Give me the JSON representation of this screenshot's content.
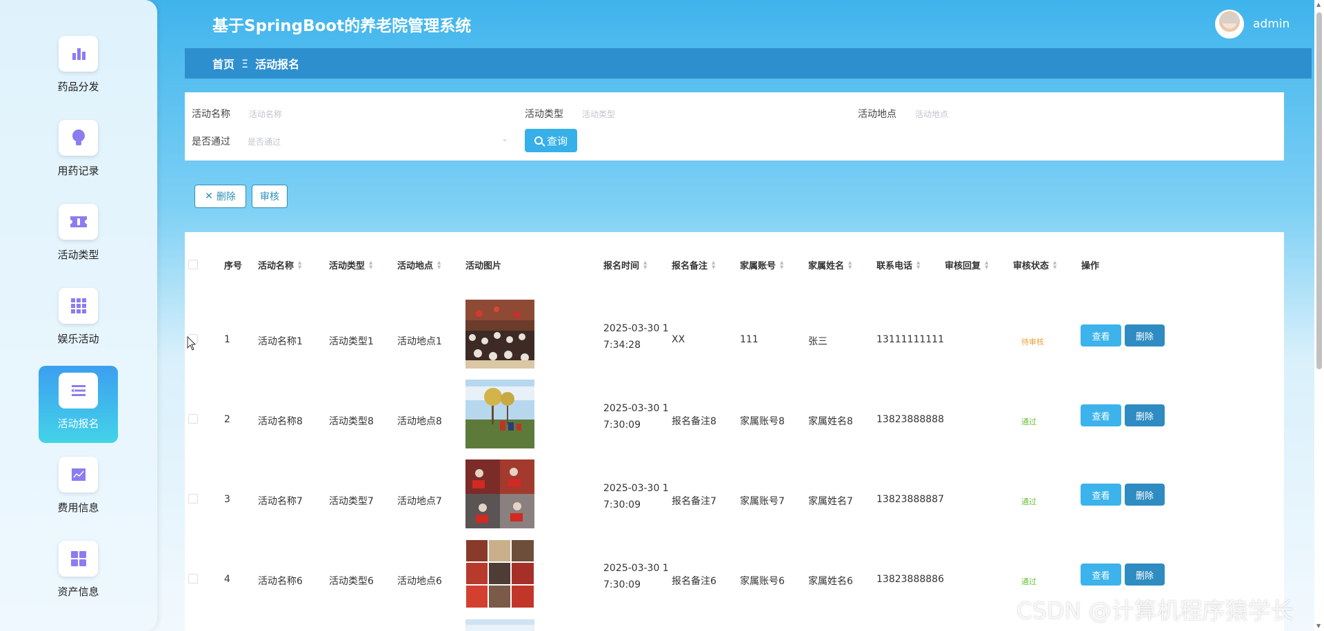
{
  "header": {
    "title": "基于SpringBoot的养老院管理系统",
    "username": "admin"
  },
  "sidebar": {
    "items": [
      {
        "label": "药品分发",
        "icon": "bar-chart-icon"
      },
      {
        "label": "用药记录",
        "icon": "lightbulb-icon"
      },
      {
        "label": "活动类型",
        "icon": "ticket-icon"
      },
      {
        "label": "娱乐活动",
        "icon": "grid-icon"
      },
      {
        "label": "活动报名",
        "icon": "list-icon",
        "active": true
      },
      {
        "label": "费用信息",
        "icon": "line-chart-icon"
      },
      {
        "label": "资产信息",
        "icon": "apps-icon"
      }
    ]
  },
  "breadcrumb": {
    "home": "首页",
    "separator": "Ξ",
    "current": "活动报名"
  },
  "search": {
    "name_label": "活动名称",
    "name_placeholder": "活动名称",
    "type_label": "活动类型",
    "type_placeholder": "活动类型",
    "place_label": "活动地点",
    "place_placeholder": "活动地点",
    "pass_label": "是否通过",
    "pass_placeholder": "是否通过",
    "search_button": "查询"
  },
  "actions": {
    "delete": "删除",
    "audit": "审核"
  },
  "table": {
    "headers": [
      "序号",
      "活动名称",
      "活动类型",
      "活动地点",
      "活动图片",
      "报名时间",
      "报名备注",
      "家属账号",
      "家属姓名",
      "联系电话",
      "审核回复",
      "审核状态",
      "操作"
    ],
    "rows": [
      {
        "index": "1",
        "name": "活动名称1",
        "type": "活动类型1",
        "place": "活动地点1",
        "time1": "2025-03-30 1",
        "time2": "7:34:28",
        "remark": "XX",
        "account": "111",
        "family_name": "张三",
        "phone": "13111111111",
        "reply": "",
        "status": "待审核"
      },
      {
        "index": "2",
        "name": "活动名称8",
        "type": "活动类型8",
        "place": "活动地点8",
        "time1": "2025-03-30 1",
        "time2": "7:30:09",
        "remark": "报名备注8",
        "account": "家属账号8",
        "family_name": "家属姓名8",
        "phone": "13823888888",
        "reply": "",
        "status": "通过"
      },
      {
        "index": "3",
        "name": "活动名称7",
        "type": "活动类型7",
        "place": "活动地点7",
        "time1": "2025-03-30 1",
        "time2": "7:30:09",
        "remark": "报名备注7",
        "account": "家属账号7",
        "family_name": "家属姓名7",
        "phone": "13823888887",
        "reply": "",
        "status": "通过"
      },
      {
        "index": "4",
        "name": "活动名称6",
        "type": "活动类型6",
        "place": "活动地点6",
        "time1": "2025-03-30 1",
        "time2": "7:30:09",
        "remark": "报名备注6",
        "account": "家属账号6",
        "family_name": "家属姓名6",
        "phone": "13823888886",
        "reply": "",
        "status": "通过"
      }
    ],
    "view_button": "查看",
    "delete_button": "删除"
  },
  "colors": {
    "pending": "#e6a23c",
    "passed": "#67c23a",
    "primary": "#37b0e9",
    "dark": "#2f8cc2"
  },
  "watermark": "CSDN @计算机程序猿学长"
}
